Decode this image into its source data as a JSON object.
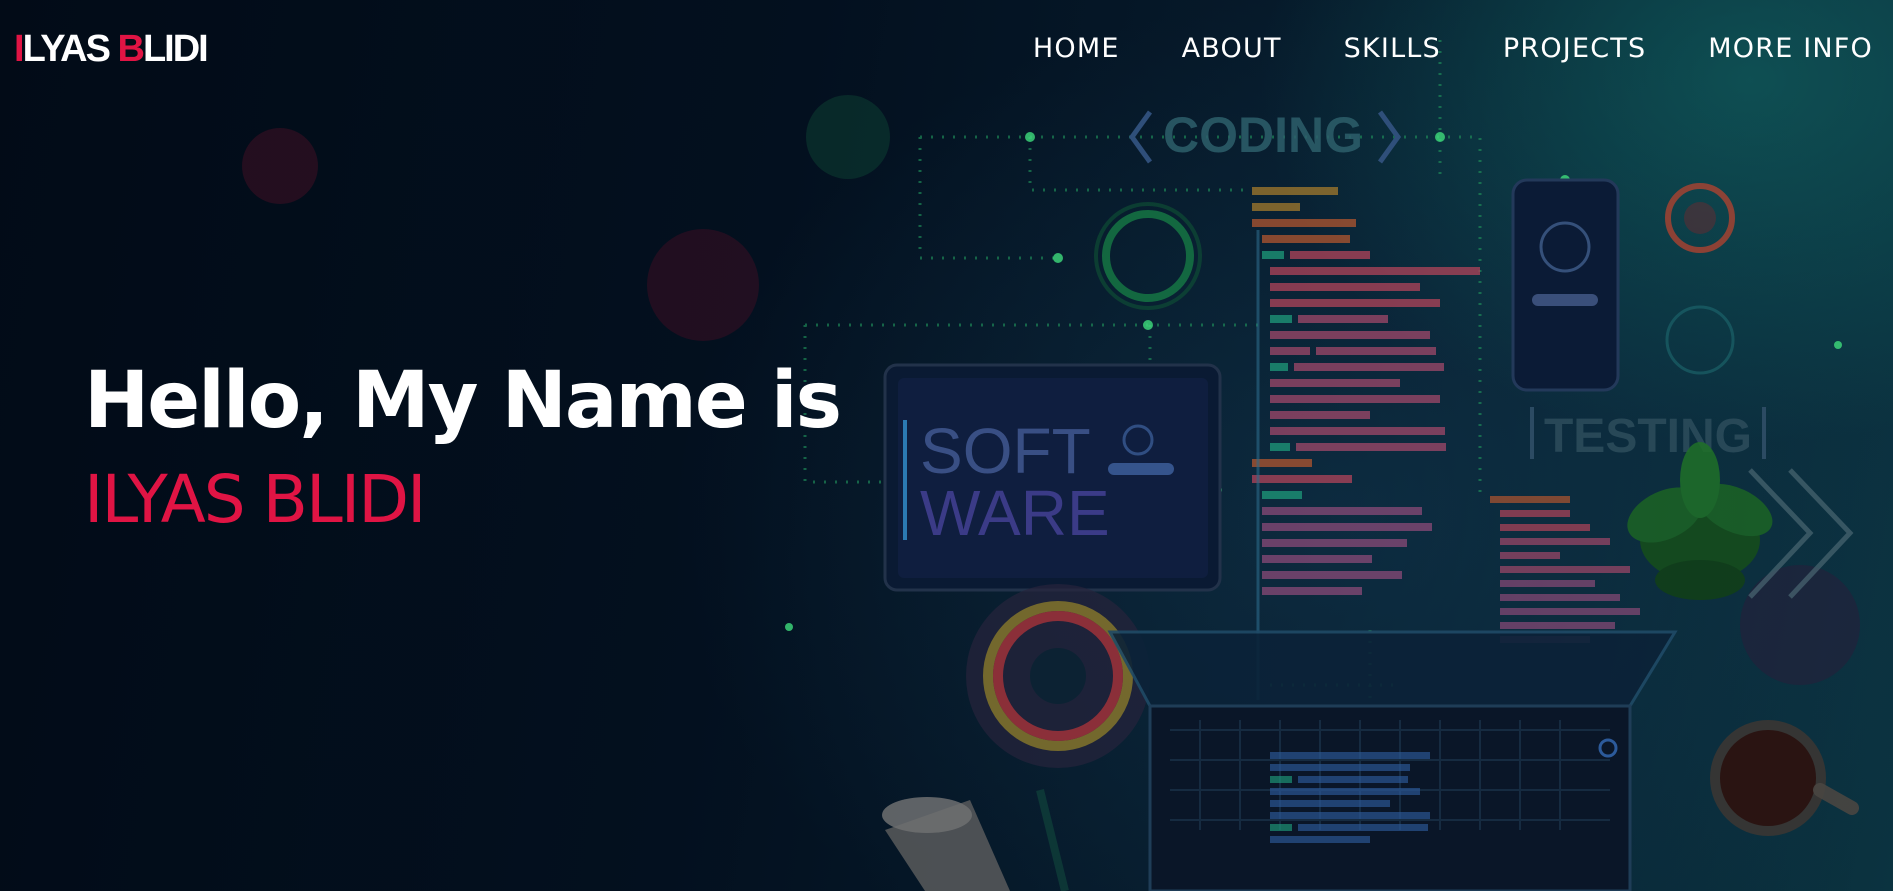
{
  "header": {
    "logo": {
      "first_letter": "I",
      "middle": "LYAS ",
      "b_letter": "B",
      "rest": "LIDI"
    },
    "nav": [
      "HOME",
      "ABOUT",
      "SKILLS",
      "PROJECTS",
      "MORE INFO"
    ]
  },
  "hero": {
    "greeting": "Hello, My Name is",
    "name": "ILYAS BLIDI",
    "illustration": {
      "coding_label": "CODING",
      "software_line1": "SOFT",
      "software_line2": "WARE",
      "testing_label": "TESTING"
    }
  },
  "colors": {
    "accent": "#e01444",
    "background": "#03101e",
    "text": "#ffffff"
  }
}
